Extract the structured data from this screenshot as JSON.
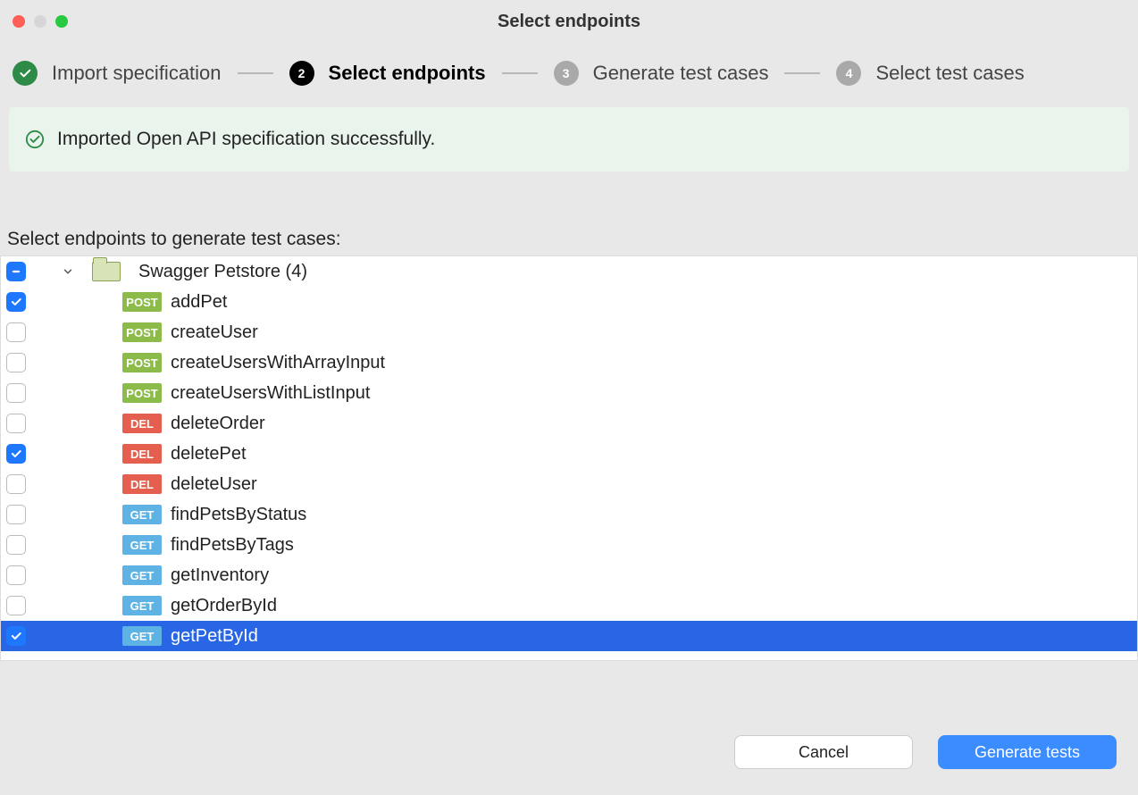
{
  "window": {
    "title": "Select endpoints"
  },
  "steps": {
    "s1": {
      "label": "Import specification"
    },
    "s2": {
      "num": "2",
      "label": "Select endpoints"
    },
    "s3": {
      "num": "3",
      "label": "Generate test cases"
    },
    "s4": {
      "num": "4",
      "label": "Select test cases"
    }
  },
  "notice": {
    "text": "Imported Open API specification successfully."
  },
  "section": {
    "label": "Select endpoints to generate test cases:"
  },
  "tree": {
    "root_label": "Swagger Petstore (4)",
    "items": [
      {
        "method": "POST",
        "name": "addPet",
        "checked": true
      },
      {
        "method": "POST",
        "name": "createUser",
        "checked": false
      },
      {
        "method": "POST",
        "name": "createUsersWithArrayInput",
        "checked": false
      },
      {
        "method": "POST",
        "name": "createUsersWithListInput",
        "checked": false
      },
      {
        "method": "DEL",
        "name": "deleteOrder",
        "checked": false
      },
      {
        "method": "DEL",
        "name": "deletePet",
        "checked": true
      },
      {
        "method": "DEL",
        "name": "deleteUser",
        "checked": false
      },
      {
        "method": "GET",
        "name": "findPetsByStatus",
        "checked": false
      },
      {
        "method": "GET",
        "name": "findPetsByTags",
        "checked": false
      },
      {
        "method": "GET",
        "name": "getInventory",
        "checked": false
      },
      {
        "method": "GET",
        "name": "getOrderById",
        "checked": false
      },
      {
        "method": "GET",
        "name": "getPetById",
        "checked": true,
        "selected": true
      }
    ]
  },
  "footer": {
    "cancel": "Cancel",
    "primary": "Generate tests"
  }
}
